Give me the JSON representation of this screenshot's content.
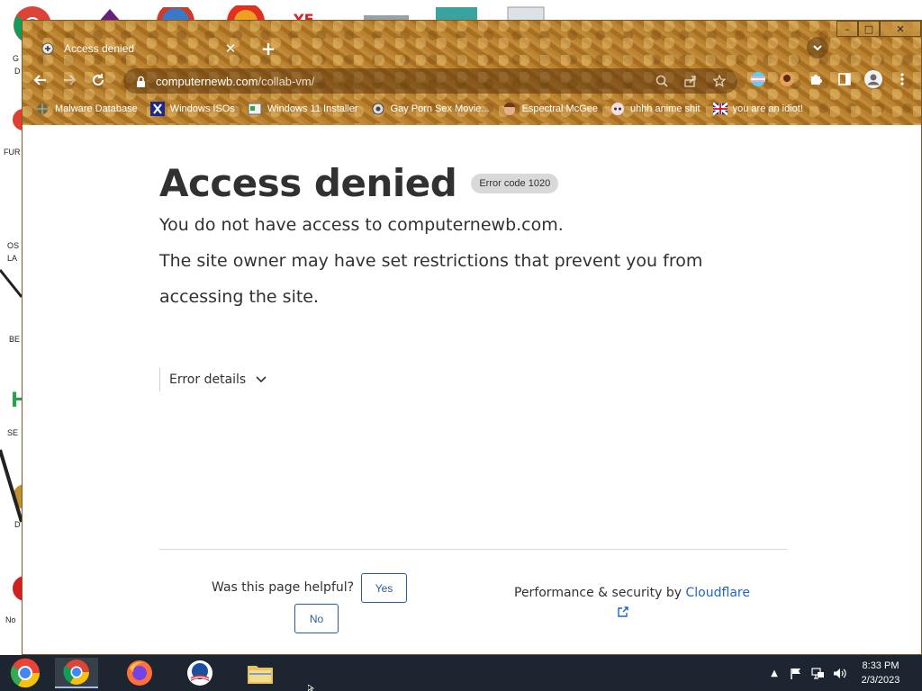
{
  "browser": {
    "tab_title": "Access denied",
    "url_host": "computernewb.com",
    "url_path": "/collab-vm/"
  },
  "bookmarks": [
    {
      "label": "Malware Database",
      "icon": "globe-icon"
    },
    {
      "label": "Windows ISOs",
      "icon": "x-logo-icon"
    },
    {
      "label": "Windows 11 Installer",
      "icon": "installer-icon"
    },
    {
      "label": "Gay Porn Sex Movie...",
      "icon": "gear-favicon-icon"
    },
    {
      "label": "Espectral McGee",
      "icon": "face-favicon-icon"
    },
    {
      "label": "uhhh anime shit",
      "icon": "anime-favicon-icon"
    },
    {
      "label": "you are an idiot!",
      "icon": "flag-favicon-icon"
    }
  ],
  "page": {
    "title": "Access denied",
    "error_badge": "Error code 1020",
    "line1": "You do not have access to computernewb.com.",
    "line2": "The site owner may have set restrictions that prevent you from",
    "line3": "accessing the site.",
    "error_details_label": "Error details",
    "helpful_question": "Was this page helpful?",
    "yes_label": "Yes",
    "no_label": "No",
    "perf_prefix": "Performance & security by ",
    "perf_brand": "Cloudflare"
  },
  "desktop_labels": [
    "G",
    "D",
    "FUR",
    "OS",
    "LA",
    "BE",
    "SE",
    "D",
    "No"
  ],
  "taskbar": {
    "apps": [
      "start-orb",
      "chrome",
      "firefox",
      "obama-logo-app",
      "file-explorer"
    ],
    "time": "8:33 PM",
    "date": "2/3/2023"
  },
  "colors": {
    "page_text": "#313131",
    "cloudflare_link": "#1e66c4",
    "button_border": "#2a5a9a",
    "taskbar": "#1c2530"
  }
}
